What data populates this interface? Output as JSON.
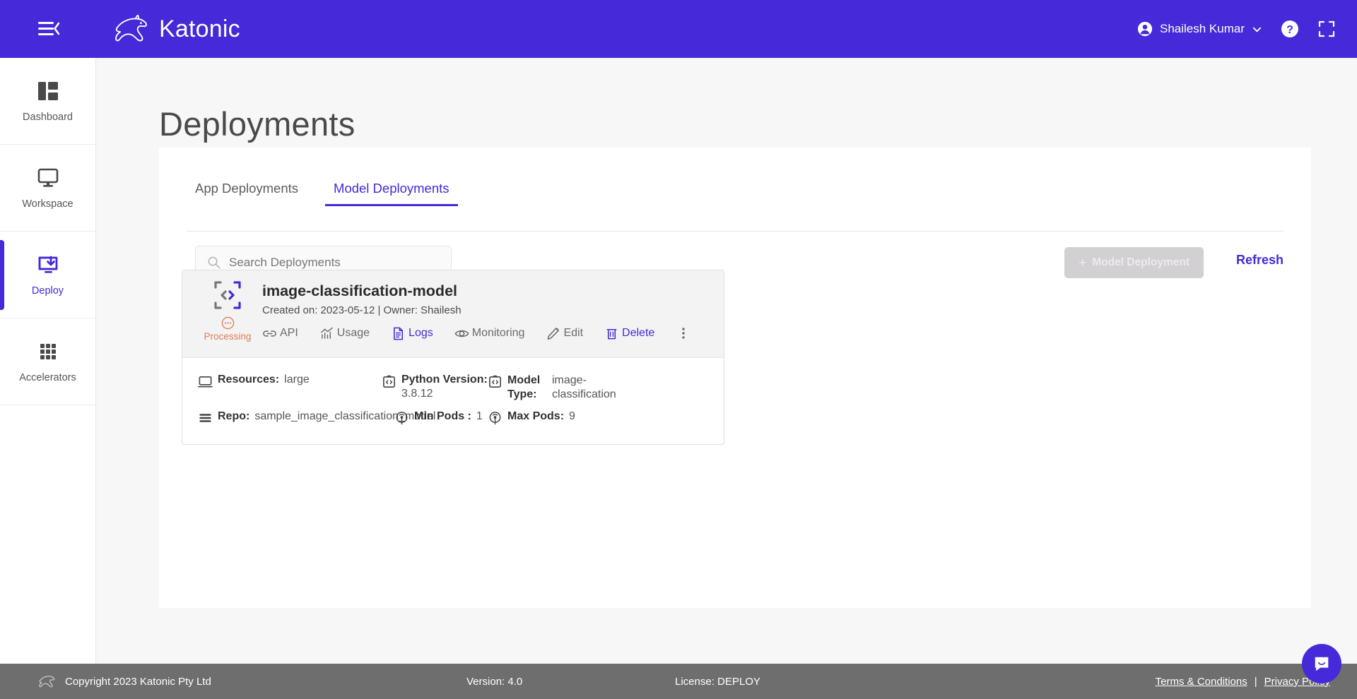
{
  "header": {
    "menu_toggle": "collapse-menu",
    "brand": "Katonic",
    "user": "Shailesh Kumar",
    "help": "help-icon",
    "fullscreen": "fullscreen-icon",
    "brand_color": "#4629d8"
  },
  "sidebar": {
    "items": [
      {
        "label": "Dashboard",
        "icon": "dashboard-icon",
        "active": false
      },
      {
        "label": "Workspace",
        "icon": "monitor-icon",
        "active": false
      },
      {
        "label": "Deploy",
        "icon": "deploy-icon",
        "active": true
      },
      {
        "label": "Accelerators",
        "icon": "grid-icon",
        "active": false
      }
    ]
  },
  "main": {
    "title": "Deployments",
    "tabs": [
      {
        "label": "App Deployments",
        "active": false
      },
      {
        "label": "Model Deployments",
        "active": true
      }
    ],
    "search": {
      "placeholder": "Search Deployments",
      "value": ""
    },
    "new_button": {
      "label": "Model Deployment",
      "plus": "+",
      "disabled": true
    },
    "refresh": "Refresh"
  },
  "card": {
    "name": "image-classification-model",
    "subtitle": "Created on: 2023-05-12 | Owner: Shailesh",
    "status": "Processing",
    "status_color": "#e07a54",
    "actions": [
      {
        "label": "API",
        "icon": "link-icon",
        "accent": false
      },
      {
        "label": "Usage",
        "icon": "chart-icon",
        "accent": false
      },
      {
        "label": "Logs",
        "icon": "document-icon",
        "accent": true
      },
      {
        "label": "Monitoring",
        "icon": "eye-icon",
        "accent": false
      },
      {
        "label": "Edit",
        "icon": "pencil-icon",
        "accent": false
      },
      {
        "label": "Delete",
        "icon": "trash-icon",
        "accent": true
      }
    ],
    "meta": {
      "resources_key": "Resources:",
      "resources_val": "large",
      "python_key": "Python Version:",
      "python_val": "3.8.12",
      "modeltype_key": "Model Type:",
      "modeltype_val": "image-classification",
      "repo_key": "Repo:",
      "repo_val": "sample_image_classification_model",
      "minpods_key": "Min Pods :",
      "minpods_val": "1",
      "maxpods_key": "Max Pods:",
      "maxpods_val": "9"
    }
  },
  "footer": {
    "copyright": "Copyright 2023 Katonic Pty Ltd",
    "version": "Version: 4.0",
    "license": "License: DEPLOY",
    "terms": "Terms & Conditions",
    "separator": "|",
    "privacy": "Privacy Policy"
  },
  "chat": {
    "label": "chat-bubble-icon"
  }
}
